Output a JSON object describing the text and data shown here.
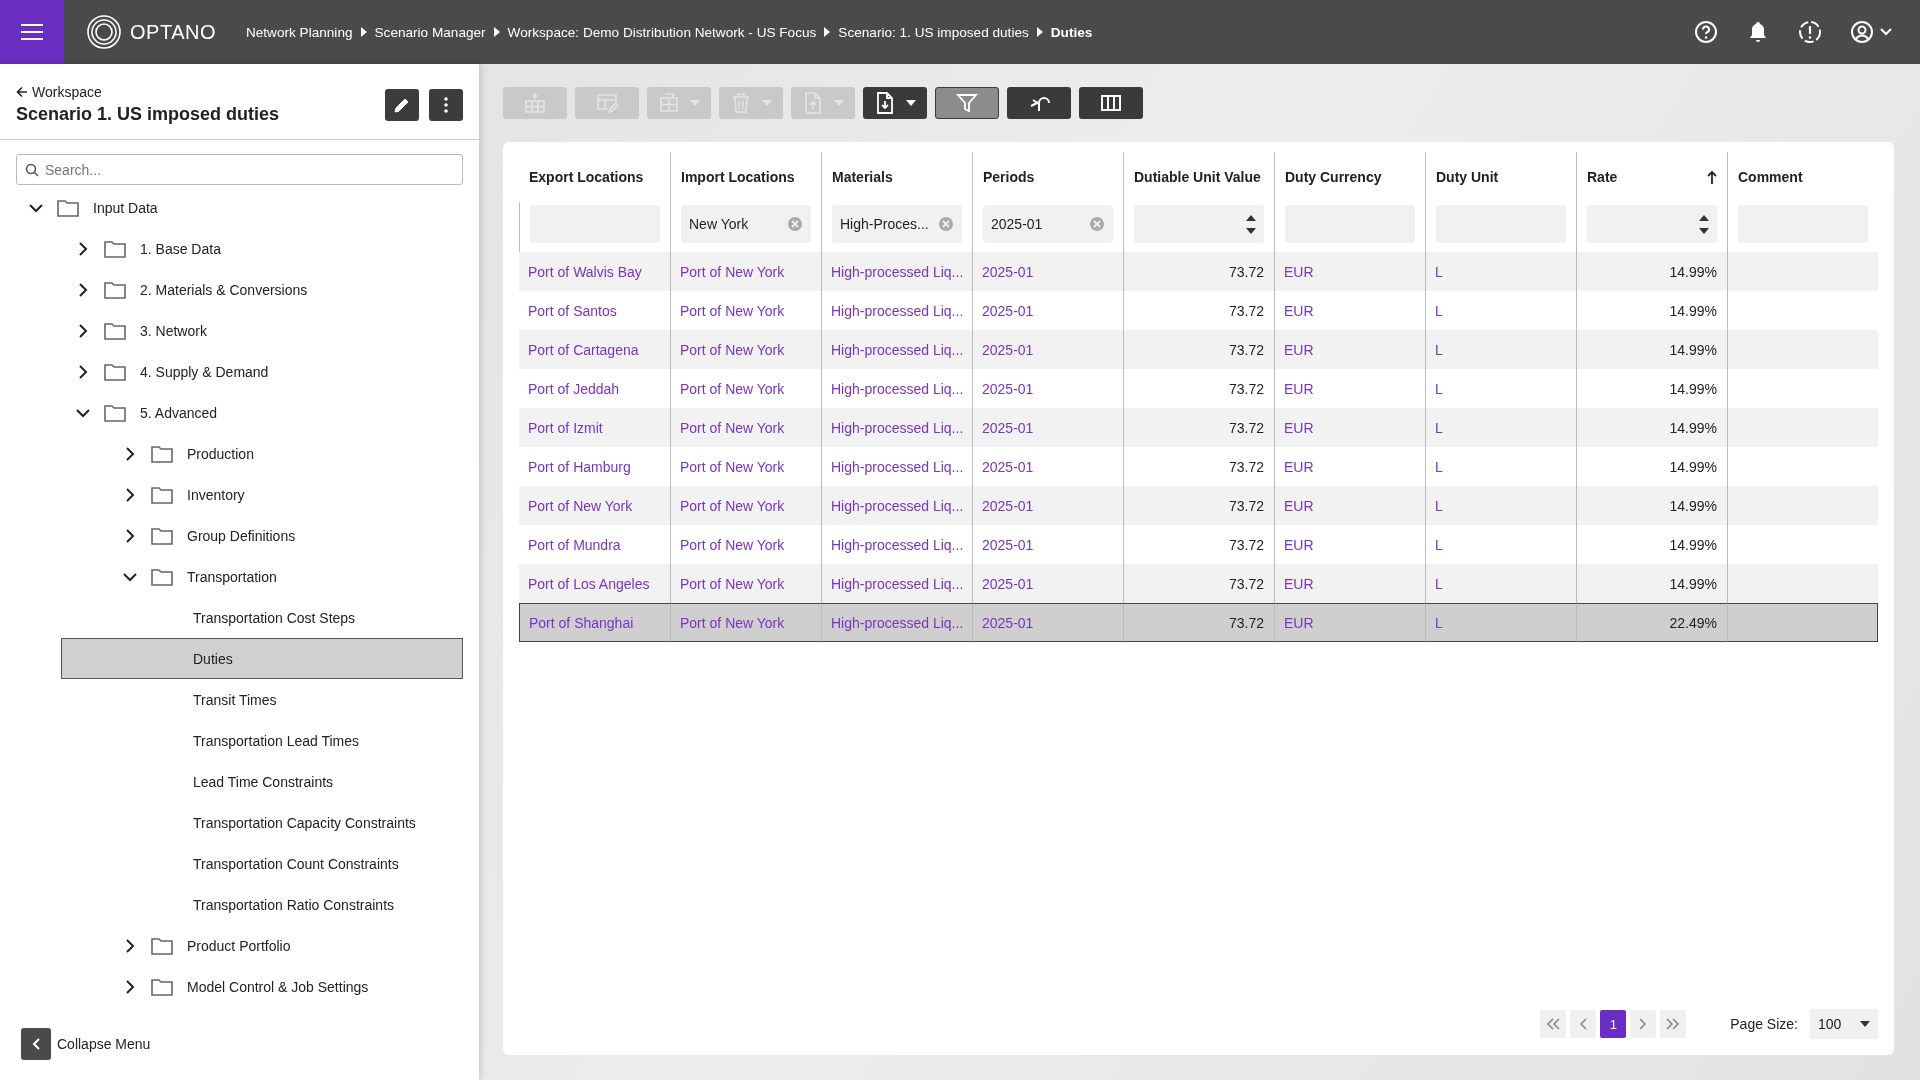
{
  "app": {
    "logo_text": "OPTANO"
  },
  "breadcrumbs": [
    {
      "label": "Network Planning",
      "current": false
    },
    {
      "label": "Scenario Manager",
      "current": false
    },
    {
      "label": "Workspace: Demo Distribution Network - US Focus",
      "current": false
    },
    {
      "label": "Scenario: 1. US imposed duties",
      "current": false
    },
    {
      "label": "Duties",
      "current": true
    }
  ],
  "header_actions": [
    {
      "kind": "help"
    },
    {
      "kind": "bell"
    },
    {
      "kind": "alert"
    },
    {
      "kind": "account"
    }
  ],
  "sidebar": {
    "back_label": "Workspace",
    "title": "Scenario 1. US imposed duties",
    "search": {
      "placeholder": "Search..."
    },
    "tree": [
      {
        "label": "Input Data",
        "kind": "folder",
        "expanded": true,
        "selected": false,
        "children": [
          {
            "label": "1. Base Data",
            "kind": "folder",
            "expanded": false,
            "selected": false
          },
          {
            "label": "2. Materials & Conversions",
            "kind": "folder",
            "expanded": false,
            "selected": false
          },
          {
            "label": "3. Network",
            "kind": "folder",
            "expanded": false,
            "selected": false
          },
          {
            "label": "4. Supply & Demand",
            "kind": "folder",
            "expanded": false,
            "selected": false
          },
          {
            "label": "5. Advanced",
            "kind": "folder",
            "expanded": true,
            "selected": false,
            "children": [
              {
                "label": "Production",
                "kind": "folder",
                "expanded": false,
                "selected": false
              },
              {
                "label": "Inventory",
                "kind": "folder",
                "expanded": false,
                "selected": false
              },
              {
                "label": "Group Definitions",
                "kind": "folder",
                "expanded": false,
                "selected": false
              },
              {
                "label": "Transportation",
                "kind": "folder",
                "expanded": true,
                "selected": false,
                "children": [
                  {
                    "label": "Transportation Cost Steps",
                    "kind": "page",
                    "selected": false
                  },
                  {
                    "label": "Duties",
                    "kind": "page",
                    "selected": true
                  },
                  {
                    "label": "Transit Times",
                    "kind": "page",
                    "selected": false
                  },
                  {
                    "label": "Transportation Lead Times",
                    "kind": "page",
                    "selected": false
                  },
                  {
                    "label": "Lead Time Constraints",
                    "kind": "page",
                    "selected": false
                  },
                  {
                    "label": "Transportation Capacity Constraints",
                    "kind": "page",
                    "selected": false
                  },
                  {
                    "label": "Transportation Count Constraints",
                    "kind": "page",
                    "selected": false
                  },
                  {
                    "label": "Transportation Ratio Constraints",
                    "kind": "page",
                    "selected": false
                  }
                ]
              },
              {
                "label": "Product Portfolio",
                "kind": "folder",
                "expanded": false,
                "selected": false
              },
              {
                "label": "Model Control & Job Settings",
                "kind": "folder",
                "expanded": false,
                "selected": false
              }
            ]
          }
        ]
      }
    ],
    "collapse_label": "Collapse Menu"
  },
  "toolbar": [
    {
      "kind": "add-row",
      "disabled": true,
      "dropdown": false,
      "on": false
    },
    {
      "kind": "edit-table",
      "disabled": true,
      "dropdown": false,
      "on": false
    },
    {
      "kind": "table",
      "disabled": true,
      "dropdown": true,
      "on": false
    },
    {
      "kind": "delete",
      "disabled": true,
      "dropdown": true,
      "on": false
    },
    {
      "kind": "import",
      "disabled": true,
      "dropdown": true,
      "on": false
    },
    {
      "kind": "export",
      "disabled": false,
      "dropdown": true,
      "on": false
    },
    {
      "kind": "filter",
      "disabled": false,
      "dropdown": false,
      "on": true
    },
    {
      "kind": "undo",
      "disabled": false,
      "dropdown": false,
      "on": false
    },
    {
      "kind": "columns",
      "disabled": false,
      "dropdown": false,
      "on": false
    }
  ],
  "table": {
    "columns": [
      {
        "label": "Export Locations",
        "kind": "link",
        "sorted": false,
        "filter": {
          "kind": "text"
        }
      },
      {
        "label": "Import Locations",
        "kind": "link",
        "sorted": false,
        "filter": {
          "kind": "text",
          "value": "New York"
        }
      },
      {
        "label": "Materials",
        "kind": "link",
        "sorted": false,
        "filter": {
          "kind": "text",
          "value": "High-Proces..."
        }
      },
      {
        "label": "Periods",
        "kind": "link",
        "sorted": false,
        "filter": {
          "kind": "text",
          "value": "2025-01"
        }
      },
      {
        "label": "Dutiable Unit Value",
        "kind": "number",
        "sorted": false,
        "filter": {
          "kind": "number"
        }
      },
      {
        "label": "Duty Currency",
        "kind": "link",
        "sorted": false,
        "filter": {
          "kind": "text"
        }
      },
      {
        "label": "Duty Unit",
        "kind": "link",
        "sorted": false,
        "filter": {
          "kind": "text"
        }
      },
      {
        "label": "Rate",
        "kind": "number",
        "sorted": true,
        "filter": {
          "kind": "number"
        }
      },
      {
        "label": "Comment",
        "kind": "text",
        "sorted": false,
        "filter": {
          "kind": "text"
        }
      }
    ],
    "rows": [
      {
        "selected": false,
        "cells": [
          "Port of Walvis Bay",
          "Port of New York",
          "High-processed Liq...",
          "2025-01",
          "73.72",
          "EUR",
          "L",
          "14.99%",
          ""
        ]
      },
      {
        "selected": false,
        "cells": [
          "Port of Santos",
          "Port of New York",
          "High-processed Liq...",
          "2025-01",
          "73.72",
          "EUR",
          "L",
          "14.99%",
          ""
        ]
      },
      {
        "selected": false,
        "cells": [
          "Port of Cartagena",
          "Port of New York",
          "High-processed Liq...",
          "2025-01",
          "73.72",
          "EUR",
          "L",
          "14.99%",
          ""
        ]
      },
      {
        "selected": false,
        "cells": [
          "Port of Jeddah",
          "Port of New York",
          "High-processed Liq...",
          "2025-01",
          "73.72",
          "EUR",
          "L",
          "14.99%",
          ""
        ]
      },
      {
        "selected": false,
        "cells": [
          "Port of Izmit",
          "Port of New York",
          "High-processed Liq...",
          "2025-01",
          "73.72",
          "EUR",
          "L",
          "14.99%",
          ""
        ]
      },
      {
        "selected": false,
        "cells": [
          "Port of Hamburg",
          "Port of New York",
          "High-processed Liq...",
          "2025-01",
          "73.72",
          "EUR",
          "L",
          "14.99%",
          ""
        ]
      },
      {
        "selected": false,
        "cells": [
          "Port of New York",
          "Port of New York",
          "High-processed Liq...",
          "2025-01",
          "73.72",
          "EUR",
          "L",
          "14.99%",
          ""
        ]
      },
      {
        "selected": false,
        "cells": [
          "Port of Mundra",
          "Port of New York",
          "High-processed Liq...",
          "2025-01",
          "73.72",
          "EUR",
          "L",
          "14.99%",
          ""
        ]
      },
      {
        "selected": false,
        "cells": [
          "Port of Los Angeles",
          "Port of New York",
          "High-processed Liq...",
          "2025-01",
          "73.72",
          "EUR",
          "L",
          "14.99%",
          ""
        ]
      },
      {
        "selected": true,
        "cells": [
          "Port of Shanghai",
          "Port of New York",
          "High-processed Liq...",
          "2025-01",
          "73.72",
          "EUR",
          "L",
          "22.49%",
          ""
        ]
      }
    ]
  },
  "pagination": {
    "pages": [
      {
        "label": "1",
        "selected": true
      }
    ],
    "page_size_label": "Page Size:",
    "page_size": "100"
  }
}
